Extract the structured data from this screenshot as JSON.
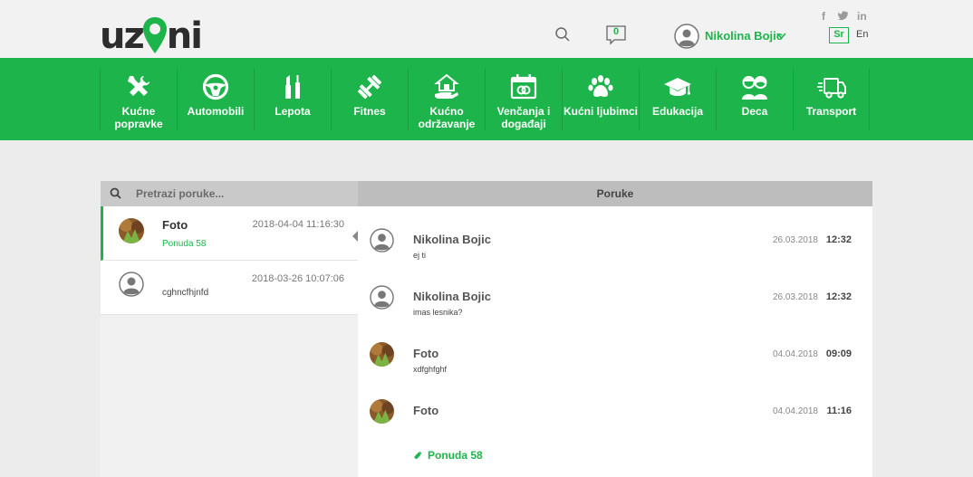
{
  "brand": {
    "logo_left": "uz",
    "logo_right": "ni",
    "accent": "#1db54b"
  },
  "header": {
    "search_icon": "search-icon",
    "messages_count": "0",
    "user_name": "Nikolina Bojic",
    "social": {
      "facebook": "f",
      "twitter": "t",
      "linkedin": "in"
    },
    "lang_sr": "Sr",
    "lang_en": "En"
  },
  "nav": {
    "items": [
      {
        "label": "Kućne popravke",
        "icon": "tools-icon"
      },
      {
        "label": "Automobili",
        "icon": "steering-wheel-icon"
      },
      {
        "label": "Lepota",
        "icon": "beauty-icon"
      },
      {
        "label": "Fitnes",
        "icon": "dumbbell-icon"
      },
      {
        "label": "Kućno održavanje",
        "icon": "house-hand-icon"
      },
      {
        "label": "Venčanja i događaji",
        "icon": "calendar-rings-icon"
      },
      {
        "label": "Kućni ljubimci",
        "icon": "paw-icon"
      },
      {
        "label": "Edukacija",
        "icon": "graduation-cap-icon"
      },
      {
        "label": "Deca",
        "icon": "children-icon"
      },
      {
        "label": "Transport",
        "icon": "truck-icon"
      }
    ]
  },
  "search": {
    "placeholder": "Pretrazi poruke..."
  },
  "messages_panel": {
    "title": "Poruke"
  },
  "conversations": [
    {
      "name": "Foto",
      "time": "2018-04-04 11:16:30",
      "subtitle": "Ponuda 58",
      "active": true
    },
    {
      "name": "",
      "time": "2018-03-26 10:07:06",
      "subtitle": "cghncfhjnfd",
      "active": false
    }
  ],
  "messages": [
    {
      "sender": "Nikolina Bojic",
      "date": "26.03.2018",
      "time": "12:32",
      "text": "ej ti",
      "avatar": "default"
    },
    {
      "sender": "Nikolina Bojic",
      "date": "26.03.2018",
      "time": "12:32",
      "text": "imas lesnika?",
      "avatar": "default"
    },
    {
      "sender": "Foto",
      "date": "04.04.2018",
      "time": "09:09",
      "text": "xdfghfghf",
      "avatar": "photo"
    },
    {
      "sender": "Foto",
      "date": "04.04.2018",
      "time": "11:16",
      "text": "",
      "attachment": "Ponuda 58",
      "avatar": "photo"
    }
  ]
}
